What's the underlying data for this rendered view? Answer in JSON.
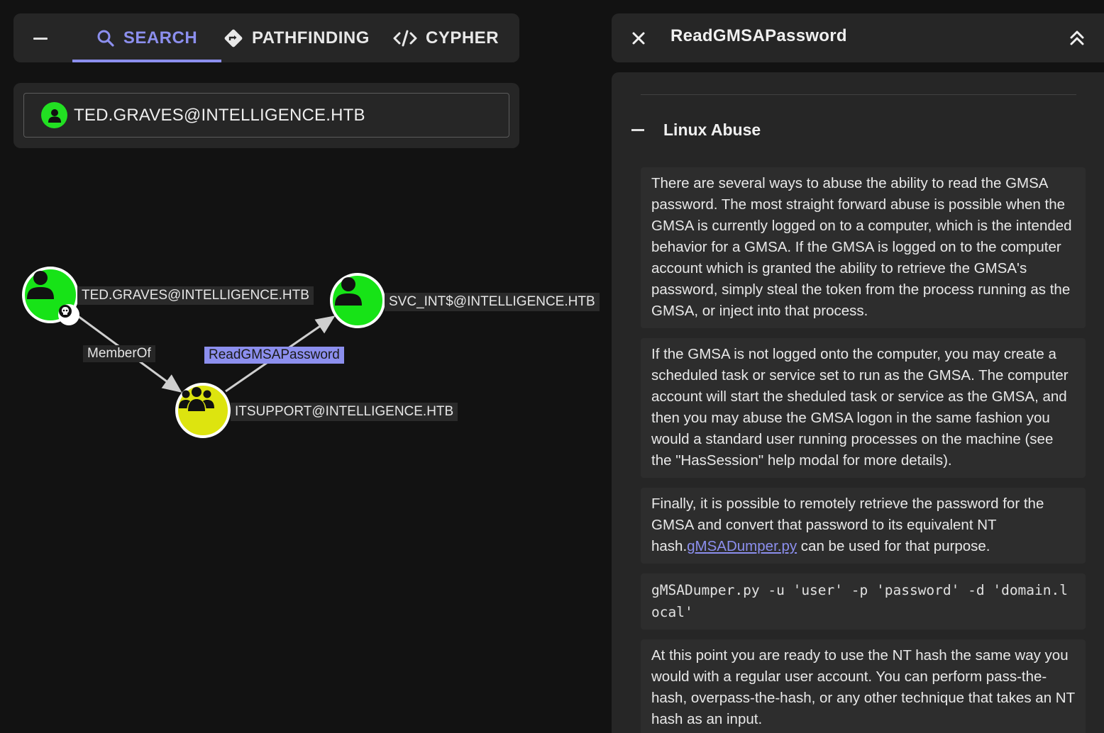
{
  "tabs": {
    "search": "SEARCH",
    "pathfinding": "PATHFINDING",
    "cypher": "CYPHER"
  },
  "search": {
    "value": "TED.GRAVES@INTELLIGENCE.HTB"
  },
  "graph": {
    "nodes": {
      "ted": "TED.GRAVES@INTELLIGENCE.HTB",
      "svc": "SVC_INT$@INTELLIGENCE.HTB",
      "itsupport": "ITSUPPORT@INTELLIGENCE.HTB"
    },
    "edges": {
      "memberof": "MemberOf",
      "readgmsa": "ReadGMSAPassword"
    }
  },
  "panel": {
    "title": "ReadGMSAPassword",
    "section_title": "Linux Abuse",
    "p1": "There are several ways to abuse the ability to read the GMSA password. The most straight forward abuse is possible when the GMSA is currently logged on to a computer, which is the intended behavior for a GMSA. If the GMSA is logged on to the computer account which is granted the ability to retrieve the GMSA's password, simply steal the token from the process running as the GMSA, or inject into that process.",
    "p2": "If the GMSA is not logged onto the computer, you may create a scheduled task or service set to run as the GMSA. The computer account will start the sheduled task or service as the GMSA, and then you may abuse the GMSA logon in the same fashion you would a standard user running processes on the machine (see the \"HasSession\" help modal for more details).",
    "p3_before": "Finally, it is possible to remotely retrieve the password for the GMSA and convert that password to its equivalent NT hash.",
    "p3_link": "gMSADumper.py",
    "p3_after": " can be used for that purpose.",
    "code": "gMSADumper.py -u 'user' -p 'password' -d 'domain.local'",
    "p4": "At this point you are ready to use the NT hash the same way you would with a regular user account. You can perform pass-the-hash, overpass-the-hash, or any other technique that takes an NT hash as an input."
  },
  "colors": {
    "accent": "#8c8fee",
    "user_node": "#17e317",
    "group_node": "#dde40f"
  },
  "icons": [
    "collapse-icon",
    "search-icon",
    "pathfinding-icon",
    "code-icon",
    "user-icon",
    "group-icon",
    "skull-icon",
    "close-icon",
    "chevron-double-up-icon"
  ]
}
